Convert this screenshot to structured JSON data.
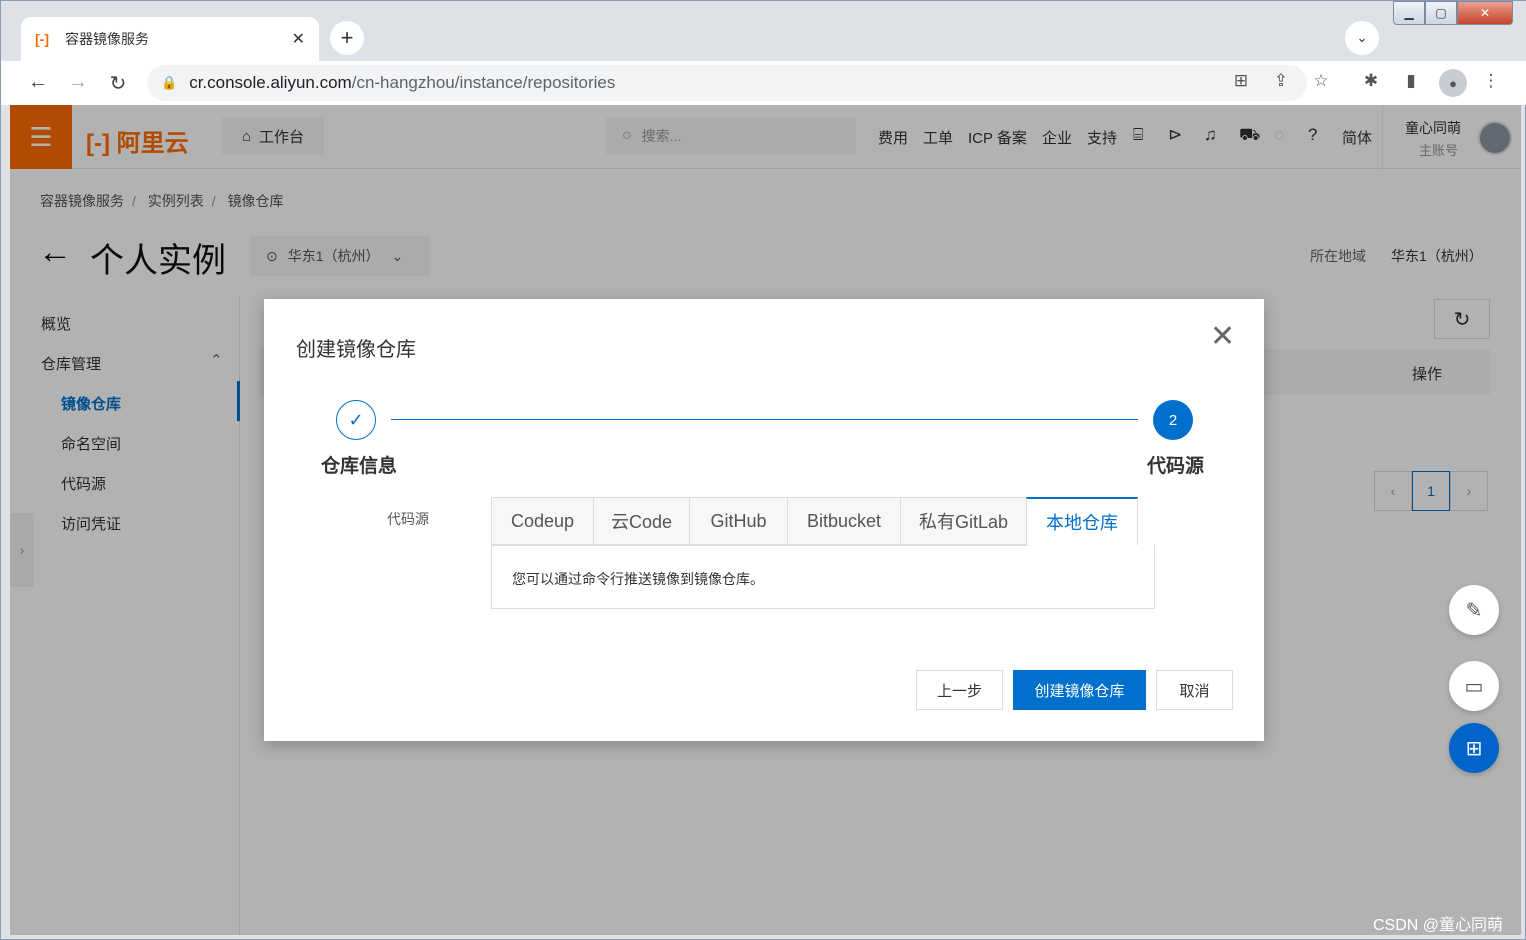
{
  "browser": {
    "tab_favicon": "[-]",
    "tab_title": "容器镜像服务",
    "tab_close": "✕",
    "new_tab": "+",
    "url_host": "cr.console.aliyun.com",
    "url_path": "/cn-hangzhou/instance/repositories"
  },
  "console": {
    "logo": "阿里云",
    "workbench": "工作台",
    "search_placeholder": "搜索...",
    "links": [
      "费用",
      "工单",
      "ICP 备案",
      "企业",
      "支持",
      "简体"
    ],
    "user_name": "童心同萌",
    "user_role": "主账号"
  },
  "breadcrumb": [
    "容器镜像服务",
    "实例列表",
    "镜像仓库"
  ],
  "page_title": "个人实例",
  "region_select": "华东1（杭州）",
  "region_label": "所在地域",
  "region_value": "华东1（杭州）",
  "sidebar": {
    "items": [
      {
        "label": "概览"
      },
      {
        "label": "仓库管理"
      },
      {
        "label": "镜像仓库"
      },
      {
        "label": "命名空间"
      },
      {
        "label": "代码源"
      },
      {
        "label": "访问凭证"
      }
    ]
  },
  "table": {
    "op_header": "操作"
  },
  "pager": {
    "current": "1"
  },
  "modal": {
    "title": "创建镜像仓库",
    "steps": [
      {
        "label": "仓库信息",
        "state": "done"
      },
      {
        "label": "代码源",
        "number": "2",
        "state": "active"
      }
    ],
    "field_label": "代码源",
    "source_tabs": [
      "Codeup",
      "云Code",
      "GitHub",
      "Bitbucket",
      "私有GitLab",
      "本地仓库"
    ],
    "active_tab": "本地仓库",
    "pane_text": "您可以通过命令行推送镜像到镜像仓库。",
    "buttons": {
      "prev": "上一步",
      "create": "创建镜像仓库",
      "cancel": "取消"
    }
  },
  "watermark": "CSDN @童心同萌",
  "colors": {
    "accent": "#0070cc",
    "brand": "#ff6a00"
  }
}
